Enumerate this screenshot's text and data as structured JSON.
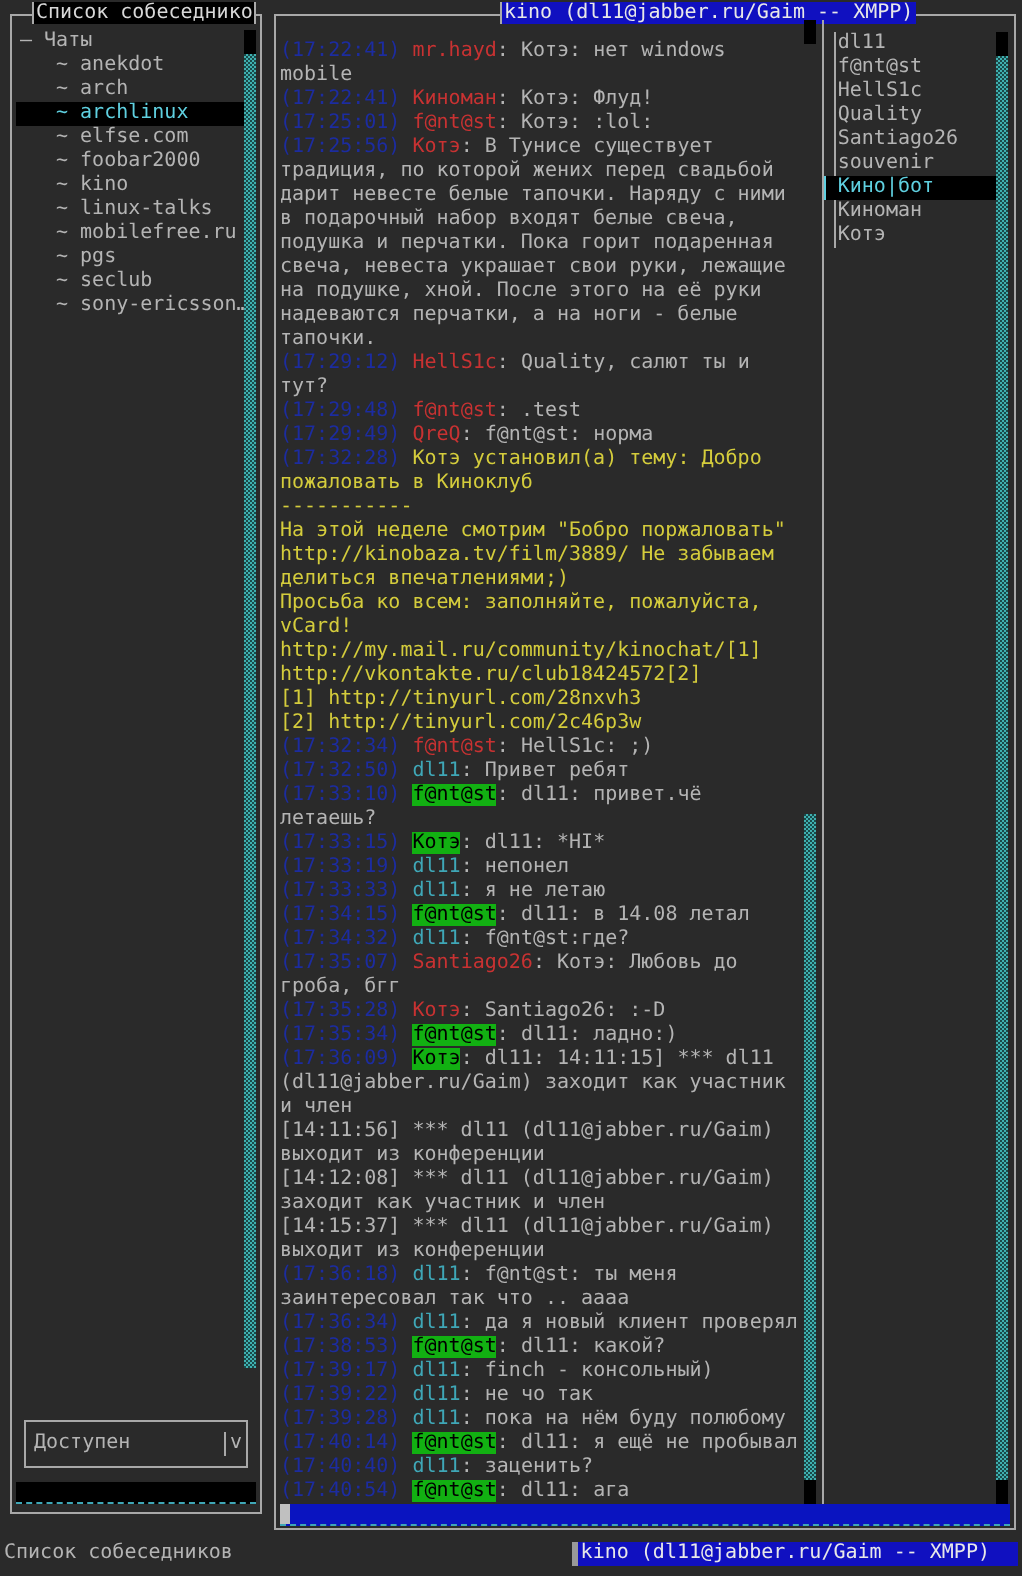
{
  "contacts_panel": {
    "title": "Список собеседнико",
    "group": {
      "toggle": "–",
      "label": "Чаты",
      "children": [
        {
          "marker": "~",
          "label": "anekdot",
          "selected": false
        },
        {
          "marker": "~",
          "label": "arch",
          "selected": false
        },
        {
          "marker": "~",
          "label": "archlinux",
          "selected": true
        },
        {
          "marker": "~",
          "label": "elfse.com",
          "selected": false
        },
        {
          "marker": "~",
          "label": "foobar2000",
          "selected": false
        },
        {
          "marker": "~",
          "label": "kino",
          "selected": false
        },
        {
          "marker": "~",
          "label": "linux-talks",
          "selected": false
        },
        {
          "marker": "~",
          "label": "mobilefree.ru",
          "selected": false
        },
        {
          "marker": "~",
          "label": "pgs",
          "selected": false
        },
        {
          "marker": "~",
          "label": "seclub",
          "selected": false
        },
        {
          "marker": "~",
          "label": "sony-ericsson…",
          "selected": false
        }
      ]
    },
    "status_select": {
      "value": "Доступен",
      "arrow": "v"
    }
  },
  "chat_window": {
    "title": "kino (dl11@jabber.ru/Gaim -- XMPP)",
    "messages": [
      {
        "kind": "message",
        "time": "(17:22:41)",
        "nick": "mr.hayd",
        "color": "#c83232",
        "highlighted": false,
        "text": ": Котэ: нет windows mobile"
      },
      {
        "kind": "message",
        "time": "(17:22:41)",
        "nick": "Киноман",
        "color": "#c83232",
        "highlighted": false,
        "text": ": Котэ: Флуд!"
      },
      {
        "kind": "message",
        "time": "(17:25:01)",
        "nick": "f@nt@st",
        "color": "#c83232",
        "highlighted": false,
        "text": ": Котэ: :lol:"
      },
      {
        "kind": "message",
        "time": "(17:25:56)",
        "nick": "Котэ",
        "color": "#c83232",
        "highlighted": false,
        "text": ": В Тунисе существует традиция, по которой жених перед свадьбой дарит невесте белые тапочки. Наряду с ними в подарочный набор входят белые свеча, подушка и перчатки. Пока горит подаренная свеча, невеста украшает свои руки, лежащие на подушке, хной. После этого на её руки надеваются перчатки, а на ноги - белые тапочки."
      },
      {
        "kind": "message",
        "time": "(17:29:12)",
        "nick": "HellS1c",
        "color": "#c83232",
        "highlighted": false,
        "text": ": Quality, салют ты и тут?"
      },
      {
        "kind": "message",
        "time": "(17:29:48)",
        "nick": "f@nt@st",
        "color": "#c83232",
        "highlighted": false,
        "text": ": .test"
      },
      {
        "kind": "message",
        "time": "(17:29:49)",
        "nick": "QreQ",
        "color": "#c83232",
        "highlighted": false,
        "text": ": f@nt@st: норма"
      },
      {
        "kind": "topic",
        "time": "(17:32:28)",
        "text": "Котэ установил(а) тему: Добро пожаловать в Киноклуб\n-----------\nНа этой неделе смотрим \"Бобро поржаловать\" http://kinobaza.tv/film/3889/ Не забываем делиться впечатлениями;)\nПросьба ко всем: заполняйте, пожалуйста, vCard!\nhttp://my.mail.ru/community/kinochat/[1]\nhttp://vkontakte.ru/club18424572[2]\n[1] http://tinyurl.com/28nxvh3\n[2] http://tinyurl.com/2c46p3w"
      },
      {
        "kind": "message",
        "time": "(17:32:34)",
        "nick": "f@nt@st",
        "color": "#c83232",
        "highlighted": false,
        "text": ": HellS1c: ;)"
      },
      {
        "kind": "message",
        "time": "(17:32:50)",
        "nick": "dl11",
        "color": "#3fa7b7",
        "highlighted": false,
        "text": ": Привет ребят"
      },
      {
        "kind": "message",
        "time": "(17:33:10)",
        "nick": "f@nt@st",
        "color": "#12b012",
        "highlighted": true,
        "text": ": dl11: привет.чё летаешь?"
      },
      {
        "kind": "message",
        "time": "(17:33:15)",
        "nick": "Котэ",
        "color": "#12b012",
        "highlighted": true,
        "text": ": dl11: *HI*"
      },
      {
        "kind": "message",
        "time": "(17:33:19)",
        "nick": "dl11",
        "color": "#3fa7b7",
        "highlighted": false,
        "text": ": непонел"
      },
      {
        "kind": "message",
        "time": "(17:33:33)",
        "nick": "dl11",
        "color": "#3fa7b7",
        "highlighted": false,
        "text": ": я не летаю"
      },
      {
        "kind": "message",
        "time": "(17:34:15)",
        "nick": "f@nt@st",
        "color": "#12b012",
        "highlighted": true,
        "text": ": dl11: в 14.08 летал"
      },
      {
        "kind": "message",
        "time": "(17:34:32)",
        "nick": "dl11",
        "color": "#3fa7b7",
        "highlighted": false,
        "text": ": f@nt@st:где?"
      },
      {
        "kind": "message",
        "time": "(17:35:07)",
        "nick": "Santiago26",
        "color": "#c83232",
        "highlighted": false,
        "text": ": Котэ: Любовь до гроба, бгг"
      },
      {
        "kind": "message",
        "time": "(17:35:28)",
        "nick": "Котэ",
        "color": "#c83232",
        "highlighted": false,
        "text": ": Santiago26: :-D"
      },
      {
        "kind": "message",
        "time": "(17:35:34)",
        "nick": "f@nt@st",
        "color": "#12b012",
        "highlighted": true,
        "text": ": dl11: ладно:)"
      },
      {
        "kind": "message",
        "time": "(17:36:09)",
        "nick": "Котэ",
        "color": "#12b012",
        "highlighted": true,
        "text": ": dl11: 14:11:15] *** dl11 (dl11@jabber.ru/Gaim) заходит как участник и член\n[14:11:56] *** dl11 (dl11@jabber.ru/Gaim) выходит из конференции\n[14:12:08] *** dl11 (dl11@jabber.ru/Gaim) заходит как участник и член\n[14:15:37] *** dl11 (dl11@jabber.ru/Gaim) выходит из конференции"
      },
      {
        "kind": "message",
        "time": "(17:36:18)",
        "nick": "dl11",
        "color": "#3fa7b7",
        "highlighted": false,
        "text": ": f@nt@st: ты меня заинтересовал так что .. аааа"
      },
      {
        "kind": "message",
        "time": "(17:36:34)",
        "nick": "dl11",
        "color": "#3fa7b7",
        "highlighted": false,
        "text": ": да я новый клиент проверял"
      },
      {
        "kind": "message",
        "time": "(17:38:53)",
        "nick": "f@nt@st",
        "color": "#12b012",
        "highlighted": true,
        "text": ": dl11: какой?"
      },
      {
        "kind": "message",
        "time": "(17:39:17)",
        "nick": "dl11",
        "color": "#3fa7b7",
        "highlighted": false,
        "text": ": finch - консольный)"
      },
      {
        "kind": "message",
        "time": "(17:39:22)",
        "nick": "dl11",
        "color": "#3fa7b7",
        "highlighted": false,
        "text": ": не чо так"
      },
      {
        "kind": "message",
        "time": "(17:39:28)",
        "nick": "dl11",
        "color": "#3fa7b7",
        "highlighted": false,
        "text": ": пока на нём буду полюбому"
      },
      {
        "kind": "message",
        "time": "(17:40:14)",
        "nick": "f@nt@st",
        "color": "#12b012",
        "highlighted": true,
        "text": ": dl11: я ещё не пробывал"
      },
      {
        "kind": "message",
        "time": "(17:40:40)",
        "nick": "dl11",
        "color": "#3fa7b7",
        "highlighted": false,
        "text": ": заценить?"
      },
      {
        "kind": "message",
        "time": "(17:40:54)",
        "nick": "f@nt@st",
        "color": "#12b012",
        "highlighted": true,
        "text": ": dl11: ага"
      }
    ],
    "participants": [
      {
        "name": "dl11",
        "selected": false
      },
      {
        "name": "f@nt@st",
        "selected": false
      },
      {
        "name": "HellS1c",
        "selected": false
      },
      {
        "name": "Quality",
        "selected": false
      },
      {
        "name": "Santiago26",
        "selected": false
      },
      {
        "name": "souvenir",
        "selected": false
      },
      {
        "name": "Кино|бот",
        "selected": true
      },
      {
        "name": "Киноман",
        "selected": false
      },
      {
        "name": "Котэ",
        "selected": false
      }
    ]
  },
  "status_bar": {
    "left": "Список собеседников",
    "window_tab": "kino (dl11@jabber.ru/Gaim -- XMPP)"
  }
}
